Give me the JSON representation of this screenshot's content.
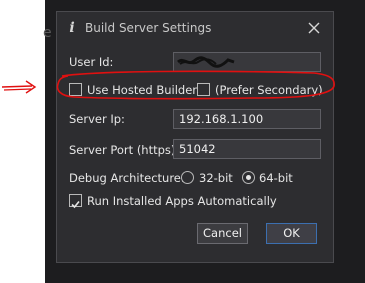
{
  "background": {
    "ghost_letter": "e"
  },
  "dialog": {
    "title": "Build Server Settings",
    "fields": {
      "user_id": {
        "label": "User Id:",
        "value": ""
      },
      "server_ip": {
        "label": "Server Ip:",
        "value": "192.168.1.100"
      },
      "server_port": {
        "label": "Server Port (https):",
        "value": "51042"
      }
    },
    "hosted_builder": {
      "label": "Use Hosted Builder",
      "checked": false
    },
    "prefer_secondary": {
      "label": "(Prefer Secondary)",
      "checked": false
    },
    "debug_arch": {
      "label": "Debug Architecture:",
      "options": [
        "32-bit",
        "64-bit"
      ],
      "selected": "64-bit"
    },
    "run_installed": {
      "label": "Run Installed Apps Automatically",
      "checked": true
    },
    "buttons": {
      "cancel": "Cancel",
      "ok": "OK"
    }
  },
  "colors": {
    "dialog_bg": "#2d2d30",
    "annotation_red": "#e01010",
    "ok_border": "#3c6fb0"
  },
  "icons": [
    "info-icon",
    "close-icon",
    "checkmark-icon",
    "red-arrow-annotation"
  ]
}
